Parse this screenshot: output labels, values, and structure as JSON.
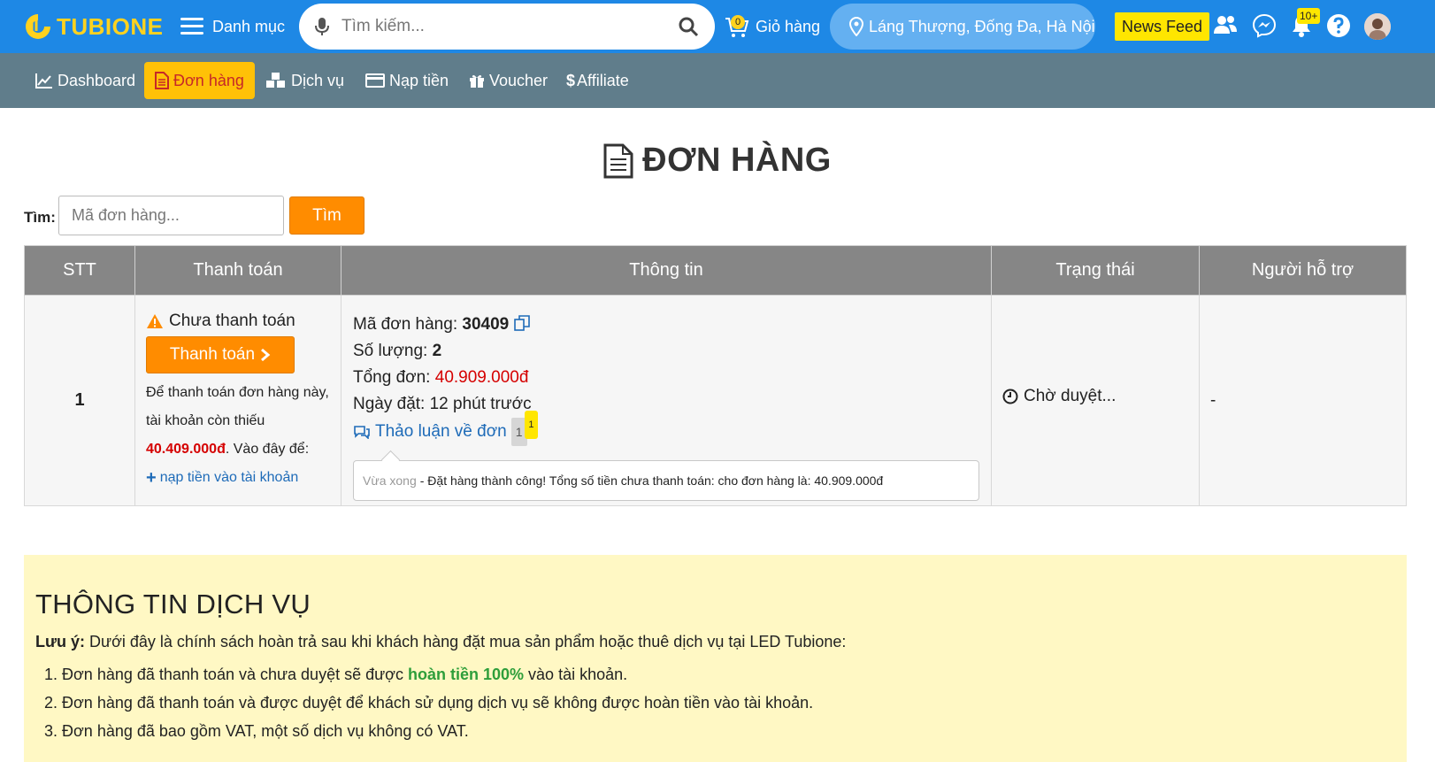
{
  "header": {
    "brand": "TUBIONE",
    "menu_label": "Danh mục",
    "search_placeholder": "Tìm kiếm...",
    "cart_label": "Giỏ hàng",
    "cart_count": "0",
    "location": "Láng Thượng, Đống Đa, Hà Nội",
    "newsfeed_label": "News Feed",
    "notification_count": "10+"
  },
  "nav": {
    "items": [
      {
        "label": "Dashboard",
        "icon": "chart-line-icon"
      },
      {
        "label": "Đơn hàng",
        "icon": "document-icon",
        "active": true
      },
      {
        "label": "Dịch vụ",
        "icon": "cubes-icon"
      },
      {
        "label": "Nạp tiền",
        "icon": "credit-card-icon"
      },
      {
        "label": "Voucher",
        "icon": "gift-icon"
      },
      {
        "label": "Affiliate",
        "icon": "dollar-icon"
      }
    ]
  },
  "page": {
    "title": "ĐƠN HÀNG",
    "find_label": "Tìm:",
    "find_placeholder": "Mã đơn hàng...",
    "find_button": "Tìm"
  },
  "table": {
    "headers": [
      "STT",
      "Thanh toán",
      "Thông tin",
      "Trạng thái",
      "Người hỗ trợ"
    ],
    "rows": [
      {
        "stt": "1",
        "payment_status": "Chưa thanh toán",
        "pay_button": "Thanh toán",
        "pay_note_1": "Để thanh toán đơn hàng này, tài khoản còn thiếu",
        "pay_missing_amount": "40.409.000đ",
        "pay_note_2": ". Vào đây để:",
        "topup_link": "nạp tiền vào tài khoản",
        "order_code_label": "Mã đơn hàng:",
        "order_code": "30409",
        "quantity_label": "Số lượng:",
        "quantity": "2",
        "total_label": "Tổng đơn:",
        "total": "40.909.000đ",
        "date_label": "Ngày đặt:",
        "date": "12 phút trước",
        "discuss_link": "Thảo luận về đơn",
        "discuss_count": "1",
        "discuss_new": "1",
        "message_time": "Vừa xong",
        "message_text": "- Đặt hàng thành công! Tổng số tiền chưa thanh toán: cho đơn hàng là: 40.909.000đ",
        "status": "Chờ duyệt...",
        "support": "-"
      }
    ]
  },
  "service": {
    "title": "THÔNG TIN DỊCH VỤ",
    "note_label": "Lưu ý:",
    "note_text": "Dưới đây là chính sách hoàn trả sau khi khách hàng đặt mua sản phẩm hoặc thuê dịch vụ tại LED Tubione:",
    "item1_before": "Đơn hàng đã thanh toán và chưa duyệt sẽ được",
    "item1_highlight": "hoàn tiền 100%",
    "item1_after": "vào tài khoản.",
    "item2": "Đơn hàng đã thanh toán và được duyệt để khách sử dụng dịch vụ sẽ không được hoàn tiền vào tài khoản.",
    "item3": "Đơn hàng đã bao gồm VAT, một số dịch vụ không có VAT."
  },
  "colors": {
    "header_bg": "#1e88e5",
    "nav_bg": "#607d8b",
    "active_nav": "#ffc107",
    "accent_orange": "#ff8c00",
    "price_red": "#d50000",
    "service_bg": "#fff8c4"
  }
}
